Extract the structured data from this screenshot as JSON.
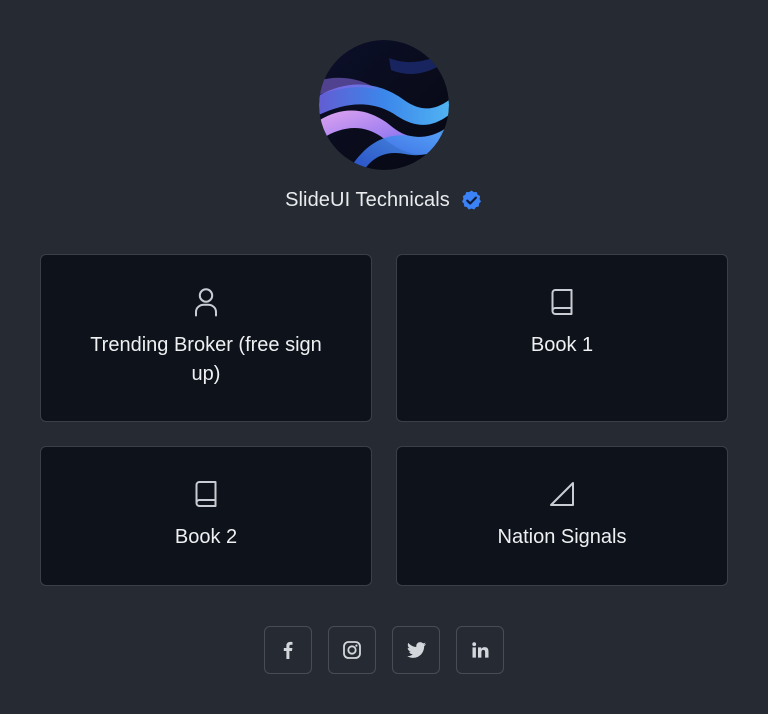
{
  "profile": {
    "name": "SlideUI Technicals",
    "verified": true,
    "accent_color": "#3b82f6"
  },
  "cards": [
    {
      "label": "Trending Broker (free sign up)",
      "icon": "user-icon"
    },
    {
      "label": "Book 1",
      "icon": "book-icon"
    },
    {
      "label": "Book 2",
      "icon": "book-icon"
    },
    {
      "label": "Nation Signals",
      "icon": "signal-icon"
    }
  ],
  "social": [
    {
      "network": "facebook",
      "icon": "facebook-icon"
    },
    {
      "network": "instagram",
      "icon": "instagram-icon"
    },
    {
      "network": "twitter",
      "icon": "twitter-icon"
    },
    {
      "network": "linkedin",
      "icon": "linkedin-icon"
    }
  ],
  "colors": {
    "background": "#262b33",
    "card_background": "#0e121a",
    "card_border": "#3a404a",
    "icon": "#c9cdd3"
  }
}
